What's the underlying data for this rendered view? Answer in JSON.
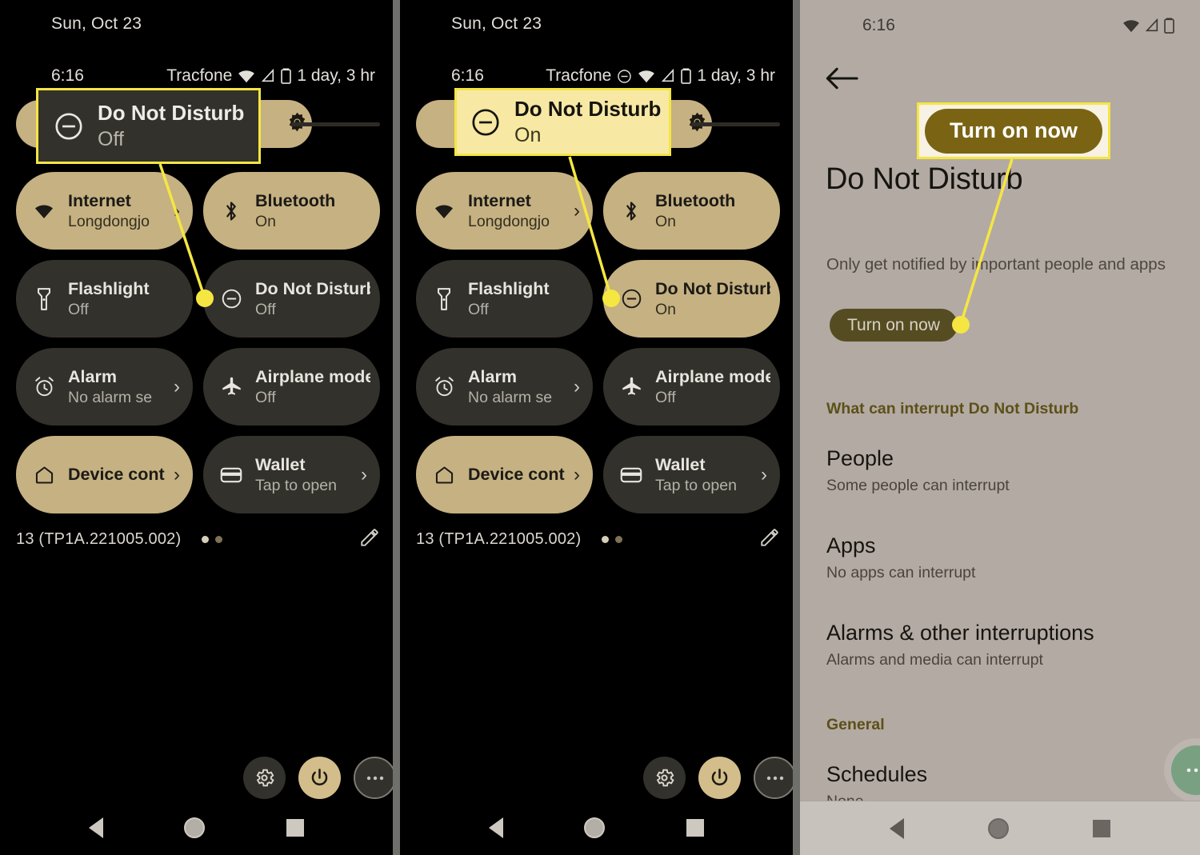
{
  "colors": {
    "highlight": "#f5e642",
    "tile_on": "#c6b182",
    "tile_off": "#33312b",
    "light_bg": "#b3aaa4",
    "cta_olive": "#7a6414",
    "fab_green": "#79a081"
  },
  "panel1": {
    "date": "Sun, Oct 23",
    "statusbar": {
      "time": "6:16",
      "carrier": "Tracfone",
      "battery": "1 day, 3 hr",
      "icons": [
        "wifi-icon",
        "signal-icon",
        "battery-icon"
      ]
    },
    "brightness": {
      "icon": "brightness-icon"
    },
    "tiles": [
      {
        "label": "Internet",
        "sub": "Longdongjo",
        "icon": "wifi-icon",
        "state": "on",
        "chevron": "›"
      },
      {
        "label": "Bluetooth",
        "sub": "On",
        "icon": "bluetooth-icon",
        "state": "on",
        "chevron": ""
      },
      {
        "label": "Flashlight",
        "sub": "Off",
        "icon": "flashlight-icon",
        "state": "off",
        "chevron": ""
      },
      {
        "label": "Do Not Disturb",
        "sub": "Off",
        "icon": "dnd-icon",
        "state": "off",
        "chevron": ""
      },
      {
        "label": "Alarm",
        "sub": "No alarm se",
        "icon": "alarm-icon",
        "state": "off",
        "chevron": "›"
      },
      {
        "label": "Airplane mode",
        "sub": "Off",
        "icon": "airplane-icon",
        "state": "off",
        "chevron": ""
      },
      {
        "label": "Device cont",
        "sub": "",
        "icon": "home-icon",
        "state": "on",
        "chevron": "›"
      },
      {
        "label": "Wallet",
        "sub": "Tap to open",
        "icon": "wallet-icon",
        "state": "off",
        "chevron": "›"
      }
    ],
    "footer": {
      "build": "13 (TP1A.221005.002)",
      "pencil": "edit-pencil-icon"
    },
    "bottom_buttons": [
      "settings-gear-icon",
      "power-icon",
      "overflow-icon"
    ],
    "nav": [
      "back-button",
      "home-button",
      "recents-button"
    ]
  },
  "panel2": {
    "date": "Sun, Oct 23",
    "statusbar": {
      "time": "6:16",
      "carrier": "Tracfone",
      "battery": "1 day, 3 hr",
      "icons": [
        "dnd-icon",
        "wifi-icon",
        "signal-icon",
        "battery-icon"
      ]
    },
    "brightness": {
      "icon": "brightness-icon"
    },
    "tiles": [
      {
        "label": "Internet",
        "sub": "Longdongjo",
        "icon": "wifi-icon",
        "state": "on",
        "chevron": "›"
      },
      {
        "label": "Bluetooth",
        "sub": "On",
        "icon": "bluetooth-icon",
        "state": "on",
        "chevron": ""
      },
      {
        "label": "Flashlight",
        "sub": "Off",
        "icon": "flashlight-icon",
        "state": "off",
        "chevron": ""
      },
      {
        "label": "Do Not Disturb",
        "sub": "On",
        "icon": "dnd-icon",
        "state": "on",
        "chevron": ""
      },
      {
        "label": "Alarm",
        "sub": "No alarm se",
        "icon": "alarm-icon",
        "state": "off",
        "chevron": "›"
      },
      {
        "label": "Airplane mode",
        "sub": "Off",
        "icon": "airplane-icon",
        "state": "off",
        "chevron": ""
      },
      {
        "label": "Device cont",
        "sub": "",
        "icon": "home-icon",
        "state": "on",
        "chevron": "›"
      },
      {
        "label": "Wallet",
        "sub": "Tap to open",
        "icon": "wallet-icon",
        "state": "off",
        "chevron": "›"
      }
    ],
    "footer": {
      "build": "13 (TP1A.221005.002)",
      "pencil": "edit-pencil-icon"
    },
    "bottom_buttons": [
      "settings-gear-icon",
      "power-icon",
      "overflow-icon"
    ],
    "nav": [
      "back-button",
      "home-button",
      "recents-button"
    ]
  },
  "panel3": {
    "statusbar": {
      "time": "6:16",
      "icons": [
        "wifi-icon",
        "signal-icon",
        "battery-icon"
      ]
    },
    "back_icon": "back-arrow-icon",
    "title": "Do Not Disturb",
    "description": "Only get notified by important people and apps",
    "cta_label": "Turn on now",
    "section1_header": "What can interrupt Do Not Disturb",
    "items": [
      {
        "title": "People",
        "sub": "Some people can interrupt"
      },
      {
        "title": "Apps",
        "sub": "No apps can interrupt"
      },
      {
        "title": "Alarms & other interruptions",
        "sub": "Alarms and media can interrupt"
      }
    ],
    "section2_header": "General",
    "items2": [
      {
        "title": "Schedules",
        "sub": "None"
      }
    ],
    "fab": "overflow-fab-icon",
    "nav": [
      "back-button",
      "home-button",
      "recents-button"
    ]
  },
  "callouts": {
    "c1": {
      "label": "Do Not Disturb",
      "sub": "Off",
      "icon": "dnd-icon"
    },
    "c2": {
      "label": "Do Not Disturb",
      "sub": "On",
      "icon": "dnd-icon"
    },
    "c3": {
      "label": "Turn on now"
    }
  }
}
